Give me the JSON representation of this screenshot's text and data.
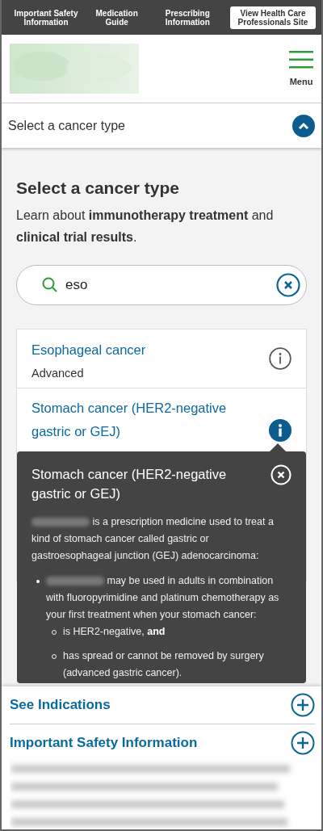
{
  "top_nav": [
    {
      "label": "Important Safety Information",
      "kind": "link"
    },
    {
      "label": "Medication Guide",
      "kind": "link"
    },
    {
      "label": "Prescribing Information",
      "kind": "link"
    },
    {
      "label": "View Health Care Professionals Site",
      "kind": "button"
    }
  ],
  "header": {
    "menu_label": "Menu"
  },
  "selector_bar": {
    "label": "Select a cancer type",
    "expanded": true
  },
  "intro": {
    "title": "Select a cancer type",
    "text": "Learn about **immunotherapy treatment** and **clinical trial results**."
  },
  "search": {
    "value": "eso"
  },
  "results": [
    {
      "title": "Esophageal cancer",
      "subtitle": "Advanced",
      "selected": false
    },
    {
      "title": "Stomach cancer (HER2-negative gastric or GEJ)",
      "selected": true
    }
  ],
  "popover": {
    "title": "Stomach cancer (HER2-negative gastric or GEJ)",
    "intro": "is a prescription medicine used to treat a kind of stomach cancer called gastric or gastroesophageal junction (GEJ) adenocarcinoma:",
    "bullets": [
      {
        "text": "may be used in adults in combination with fluoropyrimidine and platinum chemotherapy as your first treatment when your stomach cancer:",
        "sub": [
          "is HER2-negative, **and**",
          "has spread or cannot be removed by surgery (advanced gastric cancer)."
        ]
      }
    ]
  },
  "bottom_panel": [
    {
      "label": "See Indications",
      "expanded": false
    },
    {
      "label": "Important Safety Information",
      "expanded": false
    }
  ]
}
